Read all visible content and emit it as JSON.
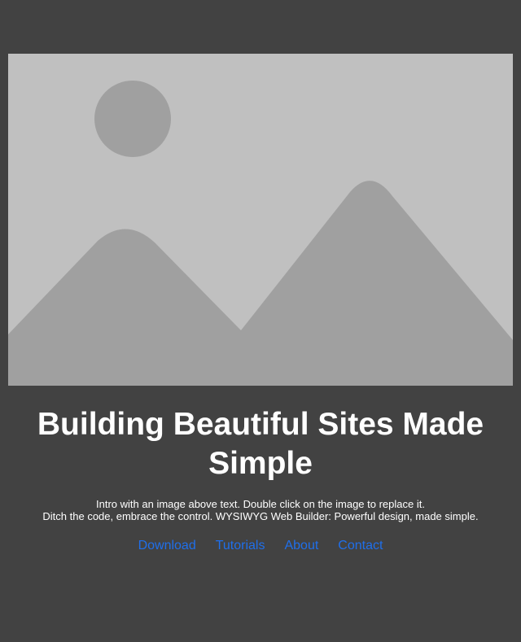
{
  "hero": {
    "image_icon": "image-placeholder-icon",
    "colors": {
      "sky": "#c0c0c0",
      "sun": "#a0a0a0",
      "mountains": "#a0a0a0"
    }
  },
  "title": "Building Beautiful Sites Made Simple",
  "intro": {
    "line1": "Intro with an image above text. Double click on the image to replace it.",
    "line2": "Ditch the code, embrace the control. WYSIWYG Web Builder: Powerful design, made simple."
  },
  "nav": {
    "download": "Download",
    "tutorials": "Tutorials",
    "about": "About",
    "contact": "Contact"
  },
  "colors": {
    "background": "#424242",
    "text": "#ffffff",
    "link": "#1f6feb"
  }
}
